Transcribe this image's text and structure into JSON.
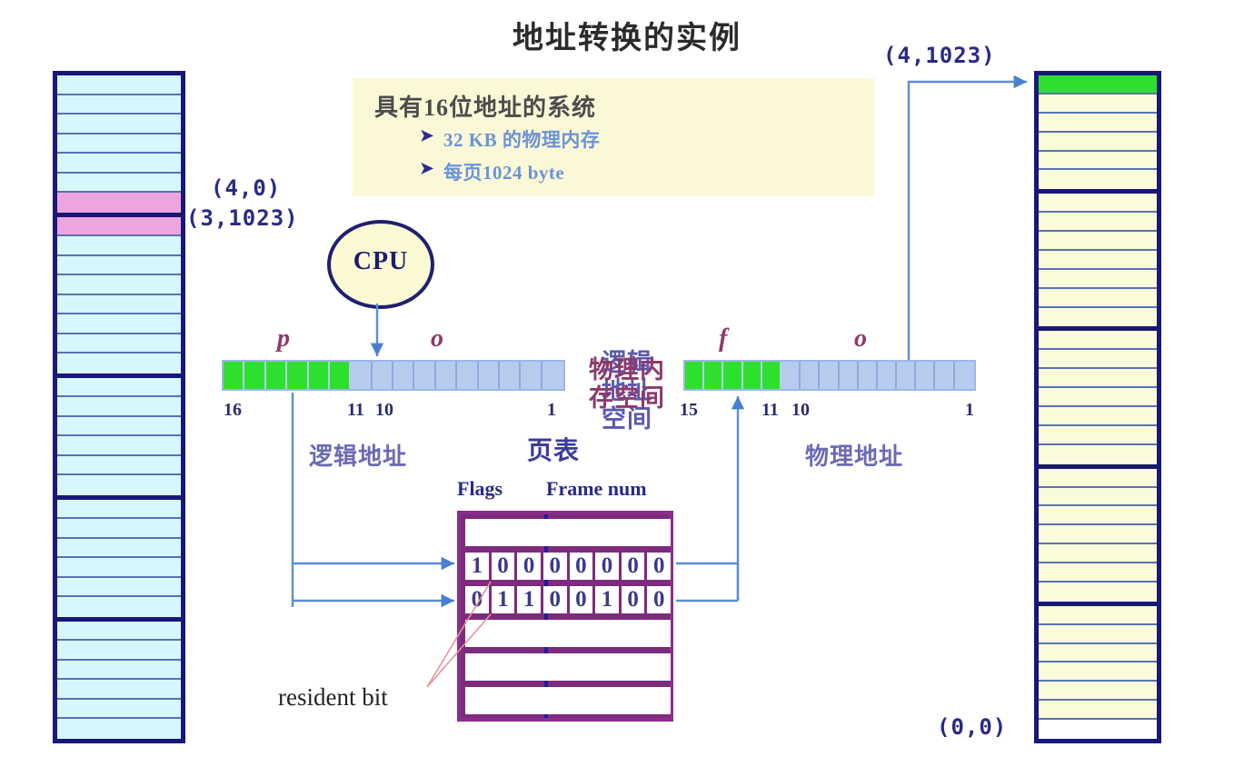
{
  "title": "地址转换的实例",
  "infobox": {
    "heading": "具有16位地址的系统",
    "bullets": [
      "32 KB 的物理内存",
      "每页1024 byte"
    ],
    "bullet_glyph": "➤",
    "bg": "#fbf8d8"
  },
  "logical_space": {
    "label": "逻辑\n地址\n空间",
    "label_lines": [
      "逻辑",
      "地址",
      "空间"
    ],
    "fill": "#d6f7fb",
    "highlight_fill": "#eda5df",
    "border": "#181878",
    "groups": [
      {
        "rows": 7,
        "highlight_rows": [
          6
        ]
      },
      {
        "rows": 8,
        "highlight_rows": [
          0
        ]
      },
      {
        "rows": 6,
        "highlight_rows": []
      },
      {
        "rows": 6,
        "highlight_rows": []
      },
      {
        "rows": 6,
        "highlight_rows": []
      }
    ]
  },
  "physical_space": {
    "label_lines": [
      "物理内",
      "存空间"
    ],
    "fill": "#fbfada",
    "green_fill": "#2ee02e",
    "border": "#181878",
    "groups": [
      {
        "rows": 6,
        "green_rows": [
          0
        ],
        "white_rows": []
      },
      {
        "rows": 7,
        "green_rows": [],
        "white_rows": []
      },
      {
        "rows": 7,
        "green_rows": [],
        "white_rows": []
      },
      {
        "rows": 7,
        "green_rows": [],
        "white_rows": []
      },
      {
        "rows": 7,
        "green_rows": [],
        "white_rows": [
          6
        ]
      }
    ]
  },
  "coords": {
    "logical_top": "(4,0)",
    "logical_bottom": "(3,1023)",
    "physical_top": "(4,1023)",
    "physical_bottom": "(0,0)",
    "color": "#2a2a86"
  },
  "cpu": {
    "label": "CPU",
    "fill": "#fbfad5",
    "border": "#202070"
  },
  "logical_address": {
    "caption": "逻辑地址",
    "field_page": "p",
    "field_offset": "o",
    "green_cells": 6,
    "blue_cells": 10,
    "bit_labels": {
      "high": "16",
      "split_high": "11",
      "split_low": "10",
      "low": "1"
    },
    "green": "#2ee02e",
    "blue": "#b7cbef"
  },
  "physical_address": {
    "caption": "物理地址",
    "field_frame": "f",
    "field_offset": "o",
    "green_cells": 5,
    "blue_cells": 10,
    "bit_labels": {
      "high": "15",
      "split_high": "11",
      "split_low": "10",
      "low": "1"
    },
    "green": "#2ee02e",
    "blue": "#b7cbef"
  },
  "page_table": {
    "title": "页表",
    "col_headers": [
      "Flags",
      "Frame num"
    ],
    "border": "#8a2f8a",
    "divider": "#1d1d9e",
    "rows": [
      {
        "type": "empty",
        "cells": []
      },
      {
        "type": "bits",
        "cells": [
          "1",
          "0",
          "0",
          "0",
          "0",
          "0",
          "0",
          "0"
        ]
      },
      {
        "type": "bits",
        "cells": [
          "0",
          "1",
          "1",
          "0",
          "0",
          "1",
          "0",
          "0"
        ]
      },
      {
        "type": "empty",
        "cells": []
      },
      {
        "type": "empty",
        "cells": []
      },
      {
        "type": "empty",
        "cells": []
      }
    ]
  },
  "annotation": {
    "resident_bit": "resident bit",
    "marker_color": "#e02020"
  },
  "arrow_color": "#5b8ed6"
}
